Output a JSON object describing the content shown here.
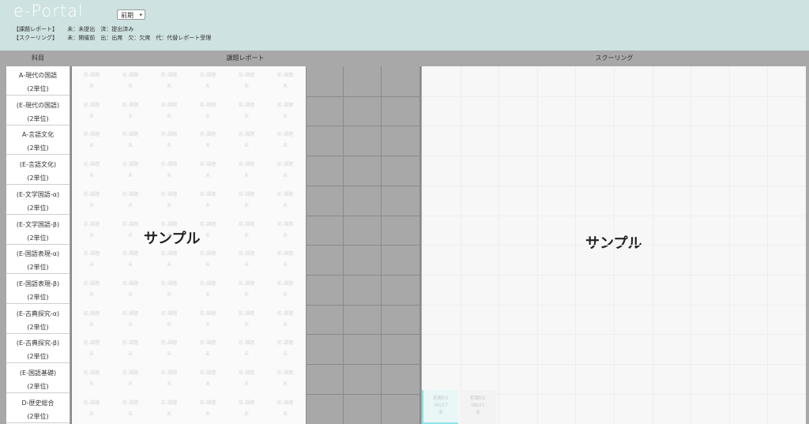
{
  "header": {
    "logo": "e-Portal",
    "term_select": "前期",
    "legend_report_label": "【課題レポート】",
    "legend_report_text": "未：未提出　済：提出済み",
    "legend_schooling_label": "【スクーリング】",
    "legend_schooling_text": "未：開催前　出：出席　欠：欠席　代：代替レポート受理"
  },
  "table": {
    "subject_header": "科目",
    "report_header": "課題レポート",
    "schooling_header": "スクーリング",
    "subjects": [
      {
        "name": "A-現代の国語",
        "units": "(2単位)"
      },
      {
        "name": "(E-現代の国語)",
        "units": "(2単位)"
      },
      {
        "name": "A-言語文化",
        "units": "(2単位)"
      },
      {
        "name": "(E-言語文化)",
        "units": "(2単位)"
      },
      {
        "name": "(E-文学国語-α)",
        "units": "(2単位)"
      },
      {
        "name": "(E-文学国語-β)",
        "units": "(2単位)"
      },
      {
        "name": "(E-国語表現-α)",
        "units": "(2単位)"
      },
      {
        "name": "(E-国語表現-β)",
        "units": "(2単位)"
      },
      {
        "name": "(E-古典探究-α)",
        "units": "(2単位)"
      },
      {
        "name": "(E-古典探究-β)",
        "units": "(2単位)"
      },
      {
        "name": "(E-国語基礎)",
        "units": "(2単位)"
      },
      {
        "name": "D-歴史総合",
        "units": "(2単位)"
      }
    ],
    "report_cell_label": "前-課題",
    "report_cell_status": "未",
    "report_sample": "サンプル",
    "schooling_sample": "サンプル",
    "schooling_cells": [
      {
        "label": "前期01",
        "date": "06/17",
        "status": "未"
      },
      {
        "label": "前期02",
        "date": "06/21",
        "status": "未"
      }
    ]
  },
  "colors": {
    "header_bg": "#cde2e1",
    "grid_bg": "#a8a8a8",
    "highlight": "#8fe3e6"
  }
}
